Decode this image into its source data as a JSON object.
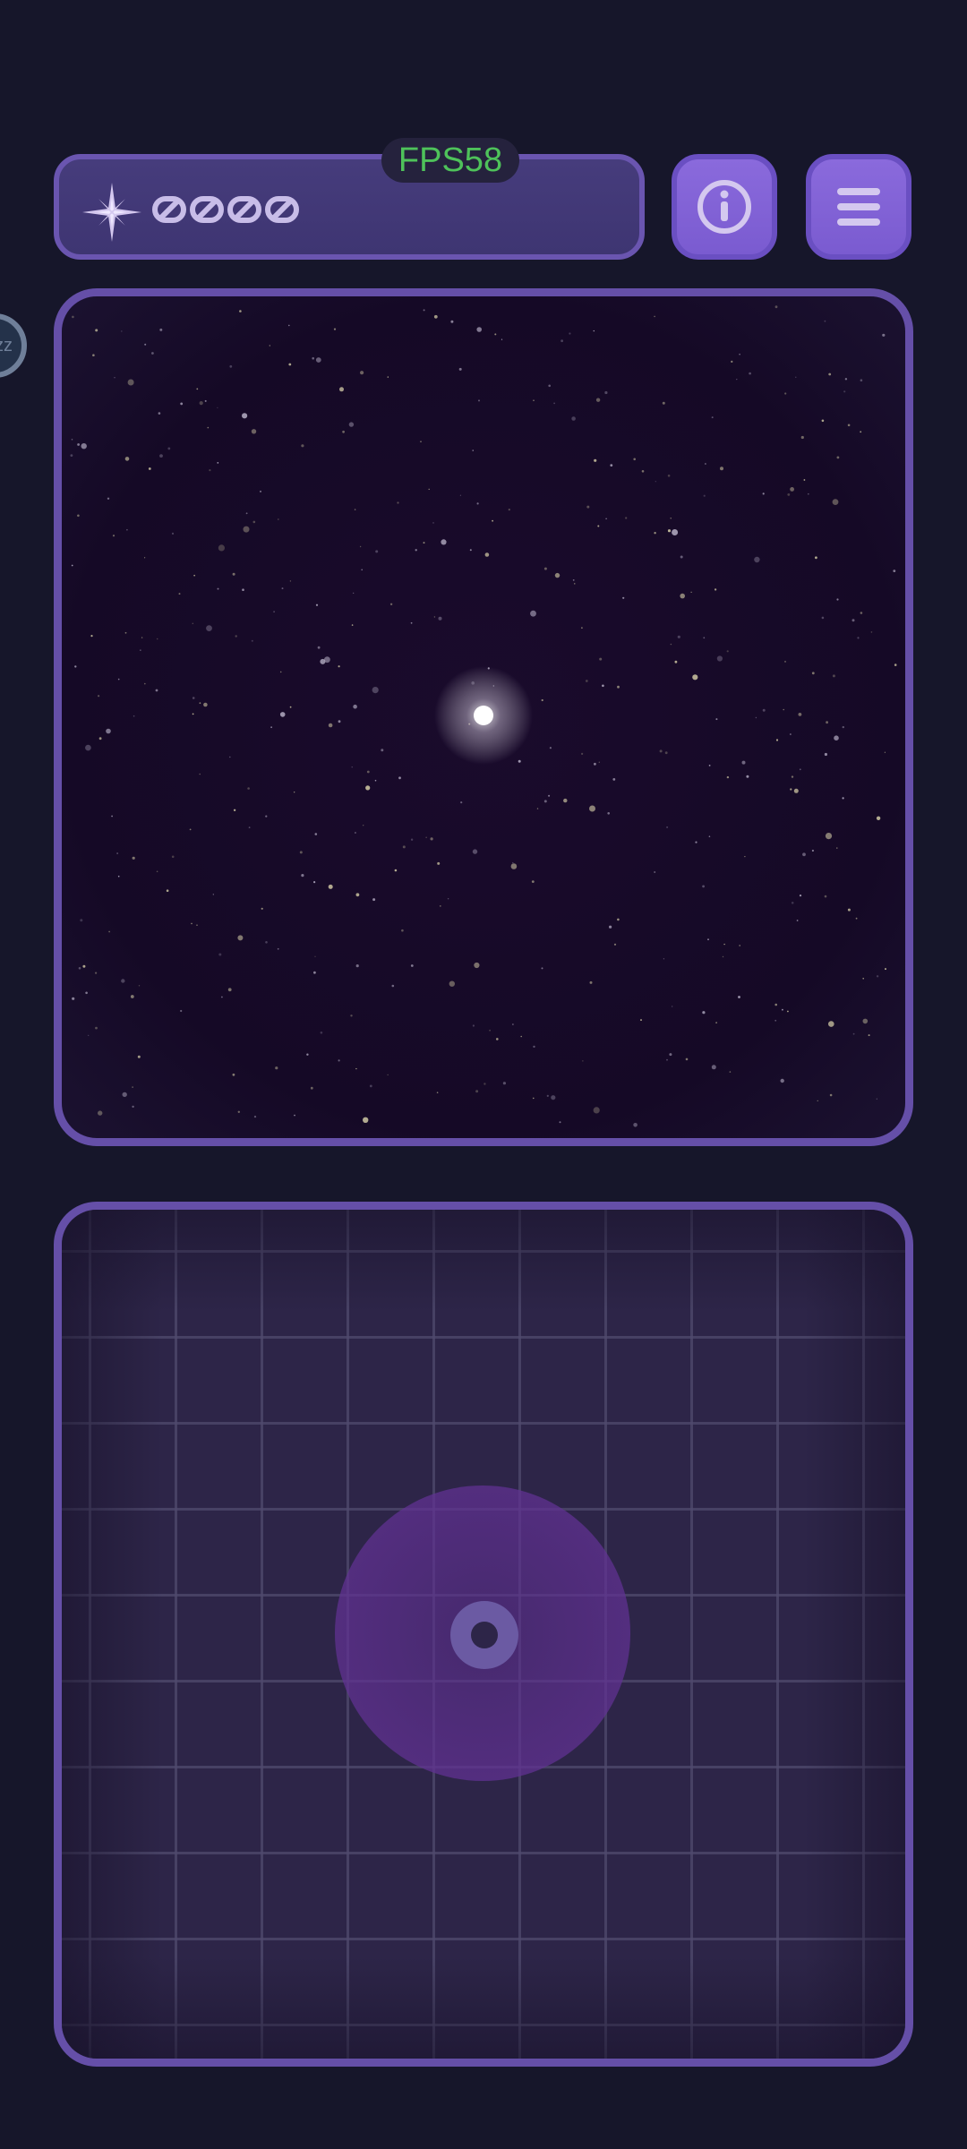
{
  "hud": {
    "score": "0000",
    "fps": "FPS58",
    "sleep_badge": "zz"
  },
  "icons": {
    "score": "sparkle-star-icon",
    "info": "info-icon",
    "menu": "hamburger-menu-icon"
  },
  "colors": {
    "fps_text": "#4ec25a",
    "panel_border": "#654fa8",
    "button": "#8a6adc",
    "background": "#16162a"
  }
}
